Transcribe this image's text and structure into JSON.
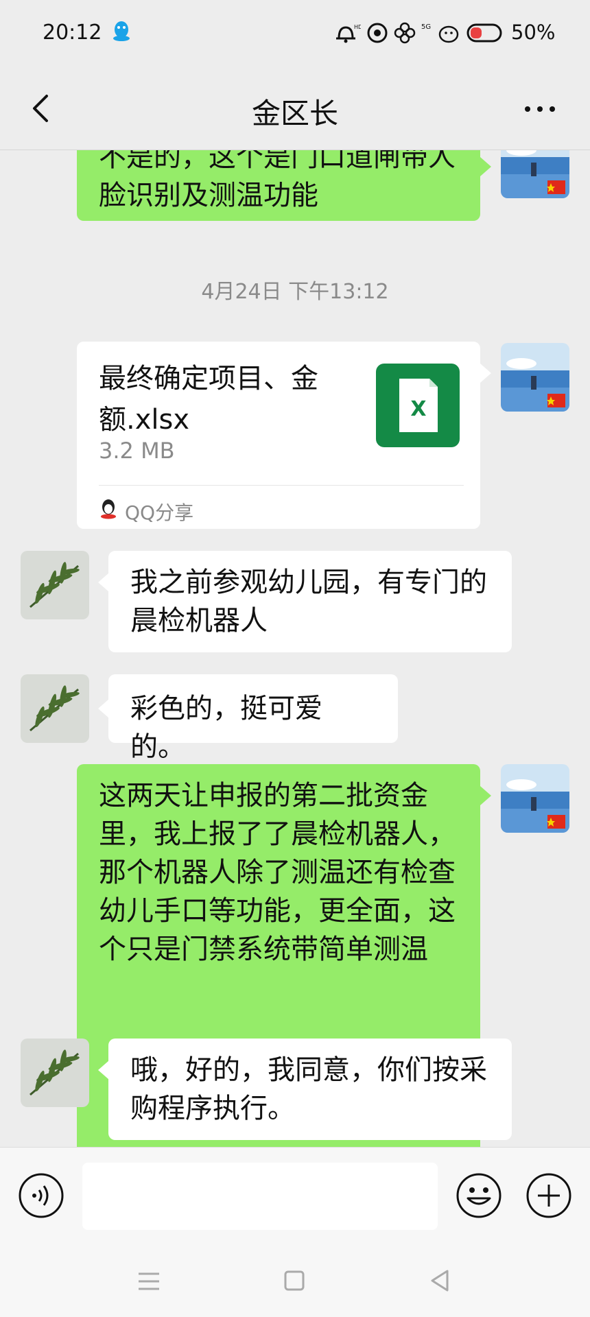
{
  "status_bar": {
    "time": "20:12",
    "battery": "50%",
    "network": "5G"
  },
  "header": {
    "title": "金区长"
  },
  "messages": [
    {
      "side": "right",
      "type": "text",
      "text": "不是的，这个是门口道闸带人脸识别及测温功能"
    },
    {
      "type": "timestamp",
      "text": "4月24日 下午13:12"
    },
    {
      "side": "right",
      "type": "file",
      "file_name": "最终确定项目、金额.xlsx",
      "file_size": "3.2 MB",
      "source": "QQ分享",
      "file_icon": "excel-x-icon"
    },
    {
      "side": "left",
      "type": "text",
      "text": "我之前参观幼儿园，有专门的晨检机器人"
    },
    {
      "side": "left",
      "type": "text",
      "text": "彩色的，挺可爱的。"
    },
    {
      "side": "right",
      "type": "text",
      "text": "这两天让申报的第二批资金里，我上报了了晨检机器人，那个机器人除了测温还有检查幼儿手口等功能，更全面，这个只是门禁系统带简单测温"
    },
    {
      "side": "left",
      "type": "text",
      "text": "哦，好的，我同意，你们按采购程序执行。"
    }
  ],
  "input": {
    "value": "",
    "placeholder": ""
  },
  "colors": {
    "sent_bubble": "#95ec69",
    "received_bubble": "#ffffff",
    "background": "#ededed",
    "excel_green": "#148a46"
  }
}
